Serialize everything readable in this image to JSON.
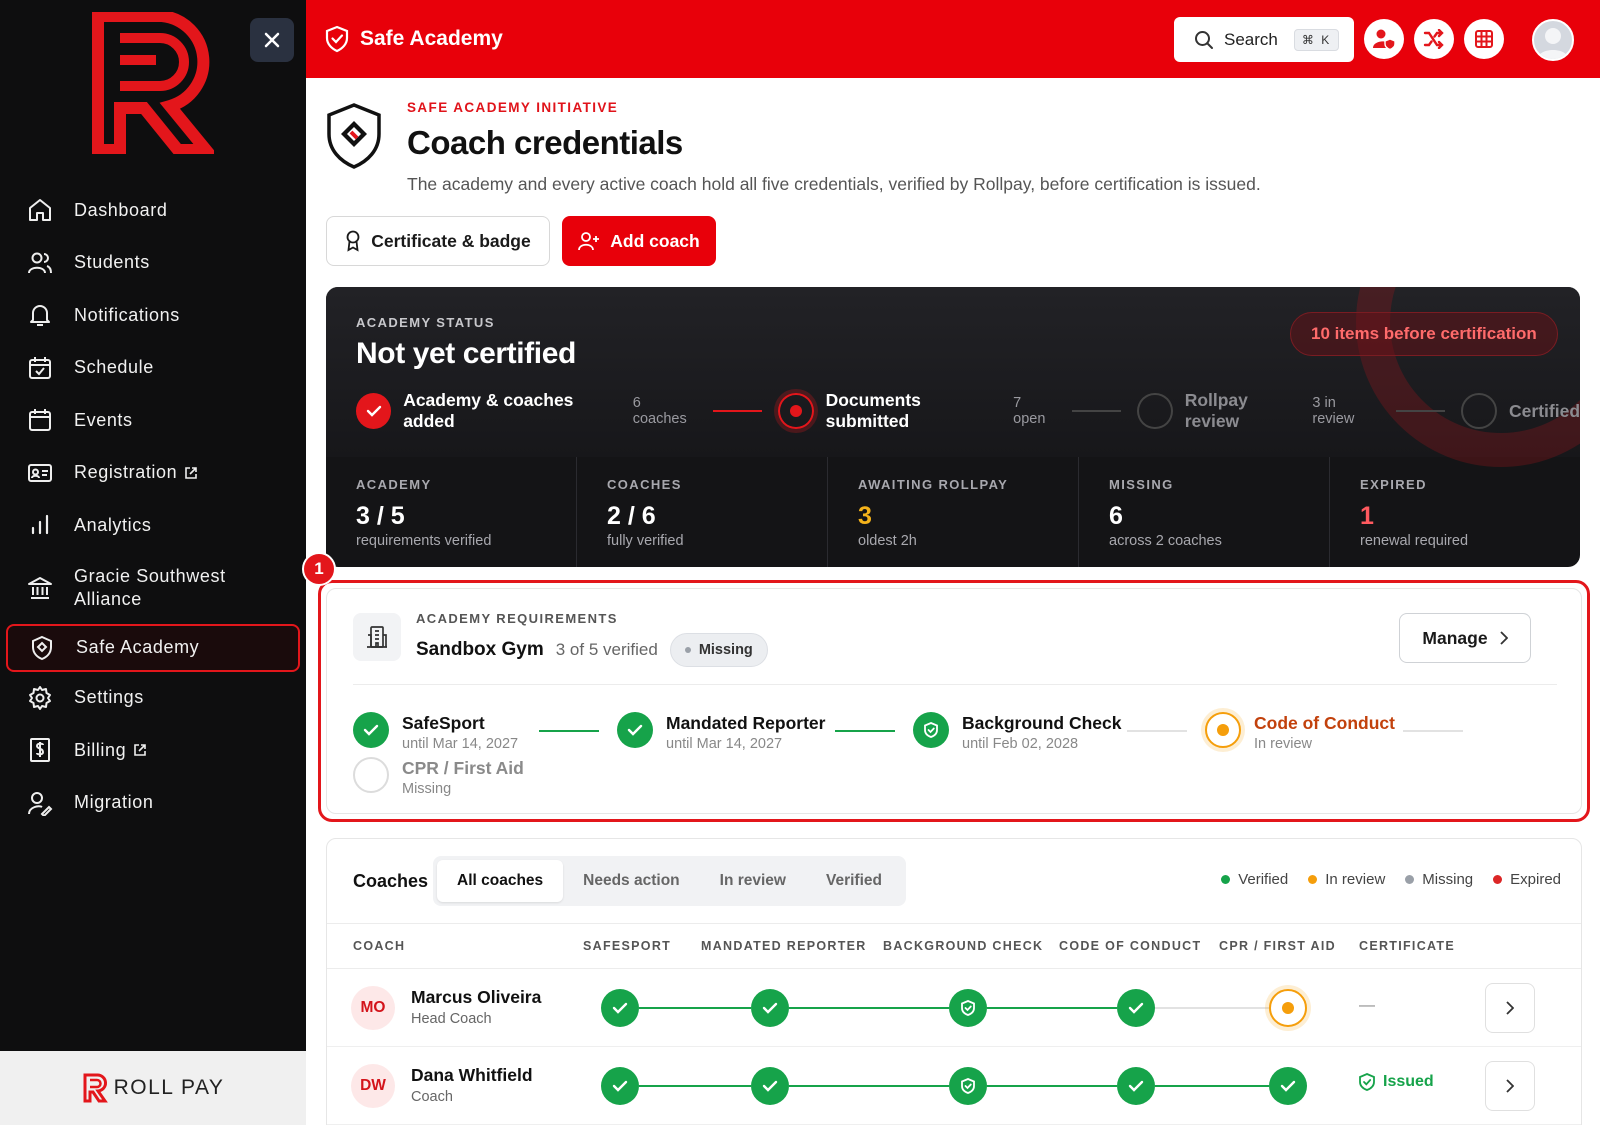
{
  "sidebar": {
    "items": [
      {
        "label": "Dashboard",
        "icon": "home-icon"
      },
      {
        "label": "Students",
        "icon": "users-icon"
      },
      {
        "label": "Notifications",
        "icon": "bell-icon"
      },
      {
        "label": "Schedule",
        "icon": "calendar-check-icon"
      },
      {
        "label": "Events",
        "icon": "calendar-icon"
      },
      {
        "label": "Registration",
        "icon": "id-card-icon"
      },
      {
        "label": "Analytics",
        "icon": "bar-chart-icon"
      },
      {
        "label": "Gracie Southwest Alliance",
        "icon": "bank-icon"
      },
      {
        "label": "Safe Academy",
        "icon": "shield-icon"
      },
      {
        "label": "Settings",
        "icon": "gear-icon"
      },
      {
        "label": "Billing",
        "icon": "dollar-doc-icon"
      },
      {
        "label": "Migration",
        "icon": "user-edit-icon"
      }
    ],
    "active": "Safe Academy",
    "footer_brand": "ROLL PAY"
  },
  "topbar": {
    "title": "Safe Academy",
    "search_label": "Search",
    "search_shortcut": "⌘ K",
    "accent": "#e8000a"
  },
  "header": {
    "eyebrow": "SAFE ACADEMY INITIATIVE",
    "title": "Coach credentials",
    "subtitle": "The academy and every active coach hold all five credentials, verified by Rollpay, before certification is issued.",
    "btn_certificate": "Certificate & badge",
    "btn_add_coach": "Add coach"
  },
  "status": {
    "label": "ACADEMY STATUS",
    "title": "Not yet certified",
    "pill": "10 items before certification",
    "steps": [
      {
        "name": "Academy & coaches added",
        "sub": "6 coaches",
        "state": "done"
      },
      {
        "name": "Documents submitted",
        "sub": "7 open",
        "state": "current"
      },
      {
        "name": "Rollpay review",
        "sub": "3 in review",
        "state": "todo"
      },
      {
        "name": "Certified",
        "sub": "",
        "state": "todo"
      }
    ],
    "metrics": [
      {
        "label": "ACADEMY",
        "value": "3 / 5",
        "sub": "requirements verified",
        "color": "#ffffff"
      },
      {
        "label": "COACHES",
        "value": "2 / 6",
        "sub": "fully verified",
        "color": "#ffffff"
      },
      {
        "label": "AWAITING ROLLPAY",
        "value": "3",
        "sub": "oldest 2h",
        "color": "#f5b31b"
      },
      {
        "label": "MISSING",
        "value": "6",
        "sub": "across 2 coaches",
        "color": "#ffffff"
      },
      {
        "label": "EXPIRED",
        "value": "1",
        "sub": "renewal required",
        "color": "#ff5a5f"
      }
    ]
  },
  "requirements": {
    "badge": "1",
    "eyebrow": "ACADEMY REQUIREMENTS",
    "name": "Sandbox Gym",
    "progress": "3 of 5 verified",
    "status_pill": "Missing",
    "manage_label": "Manage",
    "items": [
      {
        "name": "SafeSport",
        "sub": "until Mar 14, 2027",
        "state": "verified"
      },
      {
        "name": "Mandated Reporter",
        "sub": "until Mar 14, 2027",
        "state": "verified"
      },
      {
        "name": "Background Check",
        "sub": "until Feb 02, 2028",
        "state": "verified-shield"
      },
      {
        "name": "Code of Conduct",
        "sub": "In review",
        "state": "review"
      },
      {
        "name": "CPR / First Aid",
        "sub": "Missing",
        "state": "missing"
      }
    ]
  },
  "coaches": {
    "title": "Coaches",
    "tabs": [
      "All coaches",
      "Needs action",
      "In review",
      "Verified"
    ],
    "active_tab": "All coaches",
    "legend": [
      {
        "label": "Verified",
        "color": "#16a34a"
      },
      {
        "label": "In review",
        "color": "#f59e0b"
      },
      {
        "label": "Missing",
        "color": "#9aa0a8"
      },
      {
        "label": "Expired",
        "color": "#dc2626"
      }
    ],
    "columns": [
      "COACH",
      "SAFESPORT",
      "MANDATED REPORTER",
      "BACKGROUND CHECK",
      "CODE OF CONDUCT",
      "CPR / FIRST AID",
      "CERTIFICATE"
    ],
    "rows": [
      {
        "initials": "MO",
        "name": "Marcus Oliveira",
        "role": "Head Coach",
        "certificate": "—"
      },
      {
        "initials": "DW",
        "name": "Dana Whitfield",
        "role": "Coach",
        "certificate": "Issued"
      }
    ]
  }
}
